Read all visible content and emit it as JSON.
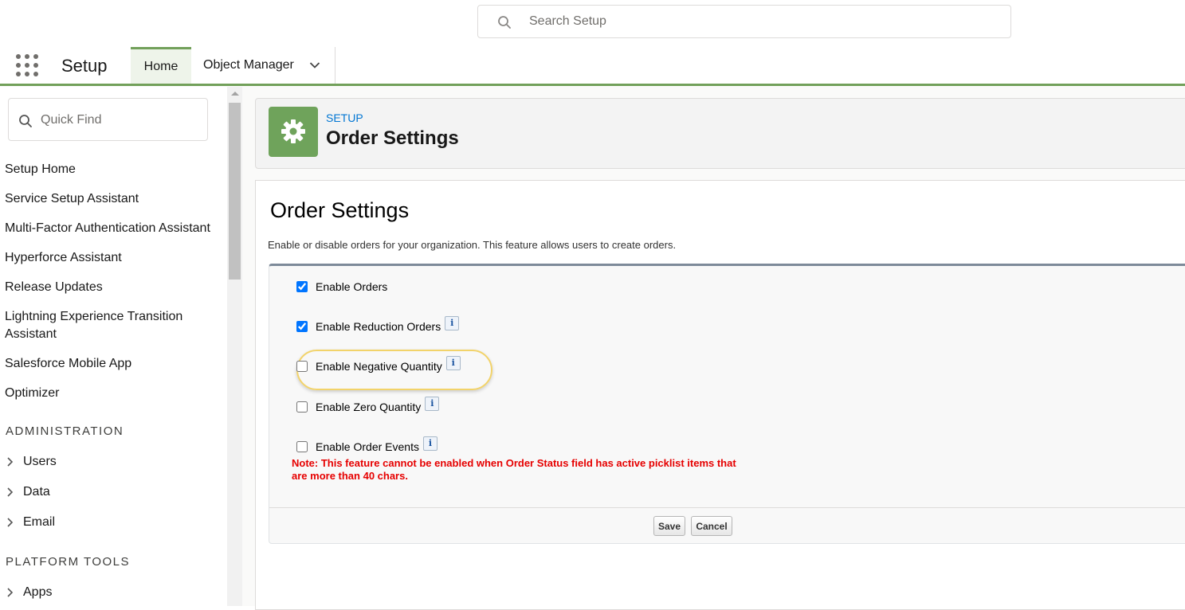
{
  "global_header": {
    "search_placeholder": "Search Setup"
  },
  "context_bar": {
    "app_name": "Setup",
    "tabs": [
      {
        "label": "Home",
        "active": true
      },
      {
        "label": "Object Manager",
        "has_dropdown": true
      }
    ]
  },
  "sidebar": {
    "quick_find_placeholder": "Quick Find",
    "links": [
      "Setup Home",
      "Service Setup Assistant",
      "Multi-Factor Authentication Assistant",
      "Hyperforce Assistant",
      "Release Updates",
      "Lightning Experience Transition Assistant",
      "Salesforce Mobile App",
      "Optimizer"
    ],
    "sections": [
      {
        "heading": "ADMINISTRATION",
        "items": [
          "Users",
          "Data",
          "Email"
        ]
      },
      {
        "heading": "PLATFORM TOOLS",
        "items": [
          "Apps"
        ]
      }
    ]
  },
  "page_header": {
    "eyebrow": "SETUP",
    "title": "Order Settings",
    "icon": "gear-icon"
  },
  "content": {
    "title": "Order Settings",
    "description": "Enable or disable orders for your organization. This feature allows users to create orders.",
    "settings": [
      {
        "label": "Enable Orders",
        "checked": true,
        "has_info": false
      },
      {
        "label": "Enable Reduction Orders",
        "checked": true,
        "has_info": true
      },
      {
        "label": "Enable Negative Quantity",
        "checked": false,
        "has_info": true,
        "highlighted": true
      },
      {
        "label": "Enable Zero Quantity",
        "checked": false,
        "has_info": true
      },
      {
        "label": "Enable Order Events",
        "checked": false,
        "has_info": true
      }
    ],
    "note": "Note: This feature cannot be enabled when Order Status field has active picklist items that are more than 40 chars.",
    "info_glyph": "i",
    "buttons": {
      "save": "Save",
      "cancel": "Cancel"
    }
  },
  "colors": {
    "accent_green": "#72a05a",
    "header_icon_bg": "#6fa35b",
    "link_blue": "#0176d3",
    "note_red": "#e60000",
    "highlight_ring": "#f2d36a"
  }
}
